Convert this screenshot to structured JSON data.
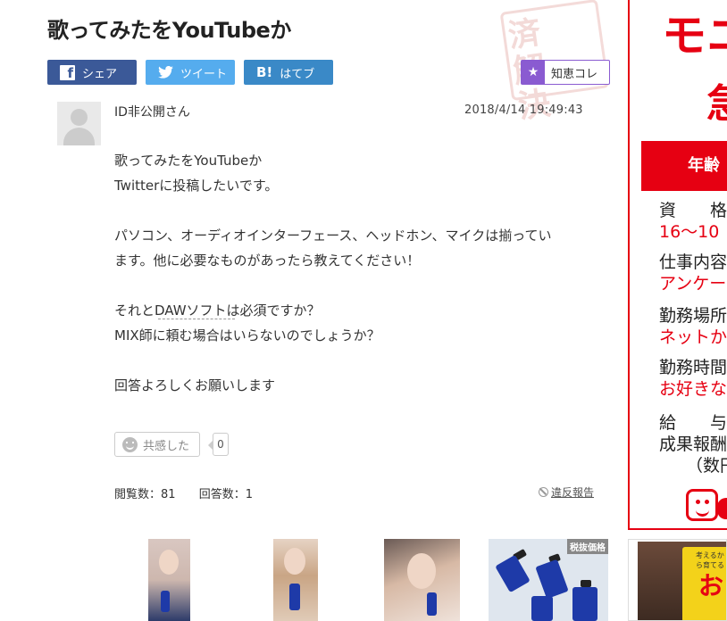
{
  "question": {
    "title": "歌ってみたをYouTubeか",
    "user": "ID非公開さん",
    "timestamp": "2018/4/14  19:49:43",
    "body": [
      "歌ってみたをYouTubeか",
      "Twitterに投稿したいです。",
      "",
      "パソコン、オーディオインターフェース、ヘッドホン、マイクは揃ってい",
      "ます。他に必要なものがあったら教えてください！",
      "",
      "それとDAWソフトは必須ですか？",
      "MIX師に頼む場合はいらないのでしょうか？",
      "",
      "回答よろしくお願いします"
    ]
  },
  "share": {
    "facebook_icon": "f",
    "facebook_label": "シェア",
    "twitter_label": "ツイート",
    "hatena_icon": "B!",
    "hatena_label": "はてブ",
    "chie_label": "知恵コレ"
  },
  "stamp": {
    "text": "済解決"
  },
  "reaction": {
    "empathy_label": "共感した",
    "empathy_count": "0"
  },
  "stats": {
    "views": "閲覧数：81",
    "answers": "回答数：1",
    "report": "違反報告"
  },
  "thumbnails": {
    "tax_badge": "税抜価格"
  },
  "ad": {
    "headline": "モニ",
    "headline2": "急",
    "banner": "年齢",
    "rows": [
      {
        "k": "資　　格",
        "v": "16〜10"
      },
      {
        "k": "仕事内容",
        "v": "アンケー"
      },
      {
        "k": "勤務場所",
        "v": "ネットか"
      },
      {
        "k": "勤務時間",
        "v": "お好きな"
      },
      {
        "k": "給　　与",
        "v": ""
      }
    ],
    "pay": "成果報酬",
    "pay_note": "（数円"
  },
  "ad2": {
    "small_text": "考えるから育てる",
    "title": "お"
  },
  "colors": {
    "facebook": "#3b5998",
    "twitter": "#55acee",
    "hatena": "#3a89c7",
    "chie": "#8a5bd1",
    "ad_red": "#e60012"
  }
}
